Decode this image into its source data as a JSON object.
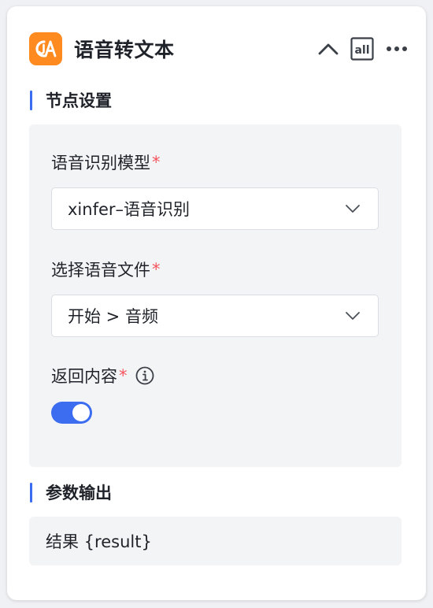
{
  "node": {
    "title": "语音转文本",
    "app_icon": "speech-to-text-icon",
    "app_icon_color": "#ff8a1f",
    "header_buttons": [
      {
        "icon": "chevron-up-icon"
      },
      {
        "icon": "all-text-icon",
        "label": "all"
      },
      {
        "icon": "more-horizontal-icon"
      }
    ]
  },
  "settings": {
    "section_title": "节点设置",
    "model_label": "语音识别模型",
    "model_value": "xinfer–语音识别",
    "file_label": "选择语音文件",
    "file_value": "开始 > 音频",
    "return_label": "返回内容",
    "required_mark": "*",
    "return_toggle_on": true
  },
  "output": {
    "section_title": "参数输出",
    "value": "结果 {result}"
  },
  "colors": {
    "accent": "#3c6df0",
    "required": "#f5545e",
    "brand": "#ff8a1f"
  }
}
